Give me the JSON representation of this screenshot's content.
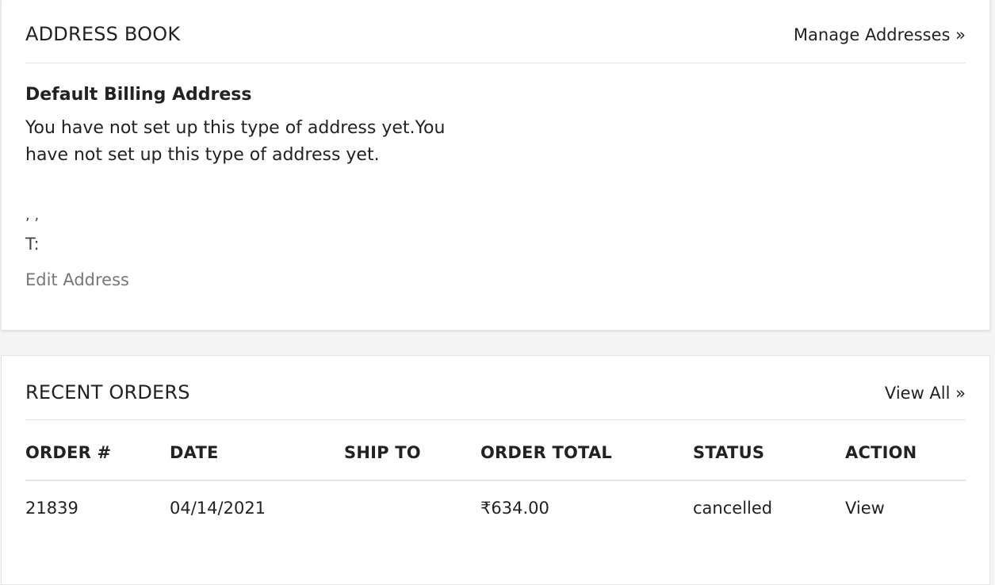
{
  "address_book": {
    "title": "ADDRESS BOOK",
    "manage_link": "Manage Addresses »",
    "default_billing": {
      "heading": "Default Billing Address",
      "message": "You have not set up this type of address yet.You have not set up this type of address yet.",
      "commas": ", ,",
      "phone": "T:",
      "edit_link": "Edit Address"
    }
  },
  "recent_orders": {
    "title": "RECENT ORDERS",
    "view_all_link": "View All »",
    "columns": [
      "ORDER #",
      "DATE",
      "SHIP TO",
      "ORDER TOTAL",
      "STATUS",
      "ACTION"
    ],
    "rows": [
      {
        "order_number": "21839",
        "date": "04/14/2021",
        "ship_to": "",
        "order_total": "₹634.00",
        "status": "cancelled",
        "action": "View"
      }
    ]
  }
}
